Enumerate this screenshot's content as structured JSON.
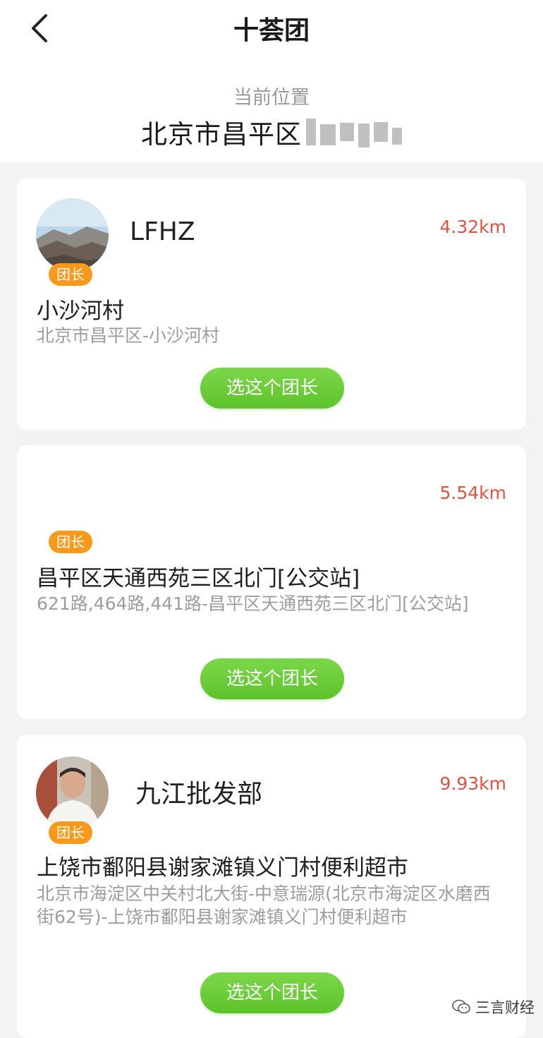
{
  "header": {
    "title": "十荟团",
    "location_label": "当前位置",
    "location_value": "北京市昌平区"
  },
  "leaders": [
    {
      "name": "LFHZ",
      "badge": "团长",
      "distance": "4.32km",
      "spot": "小沙河村",
      "address": "北京市昌平区-小沙河村",
      "button": "选这个团长"
    },
    {
      "name": "",
      "badge": "团长",
      "distance": "5.54km",
      "spot": "昌平区天通西苑三区北门[公交站]",
      "address": "621路,464路,441路-昌平区天通西苑三区北门[公交站]",
      "button": "选这个团长"
    },
    {
      "name": "九江批发部",
      "badge": "团长",
      "distance": "9.93km",
      "spot": "上饶市鄱阳县谢家滩镇义门村便利超市",
      "address": "北京市海淀区中关村北大街-中意瑞源(北京市海淀区水磨西街62号)-上饶市鄱阳县谢家滩镇义门村便利超市",
      "button": "选这个团长"
    }
  ],
  "watermark": {
    "text": "三言财经"
  },
  "colors": {
    "badge": "#f79a1b",
    "distance": "#e0533f",
    "button": "#6ccb36"
  }
}
